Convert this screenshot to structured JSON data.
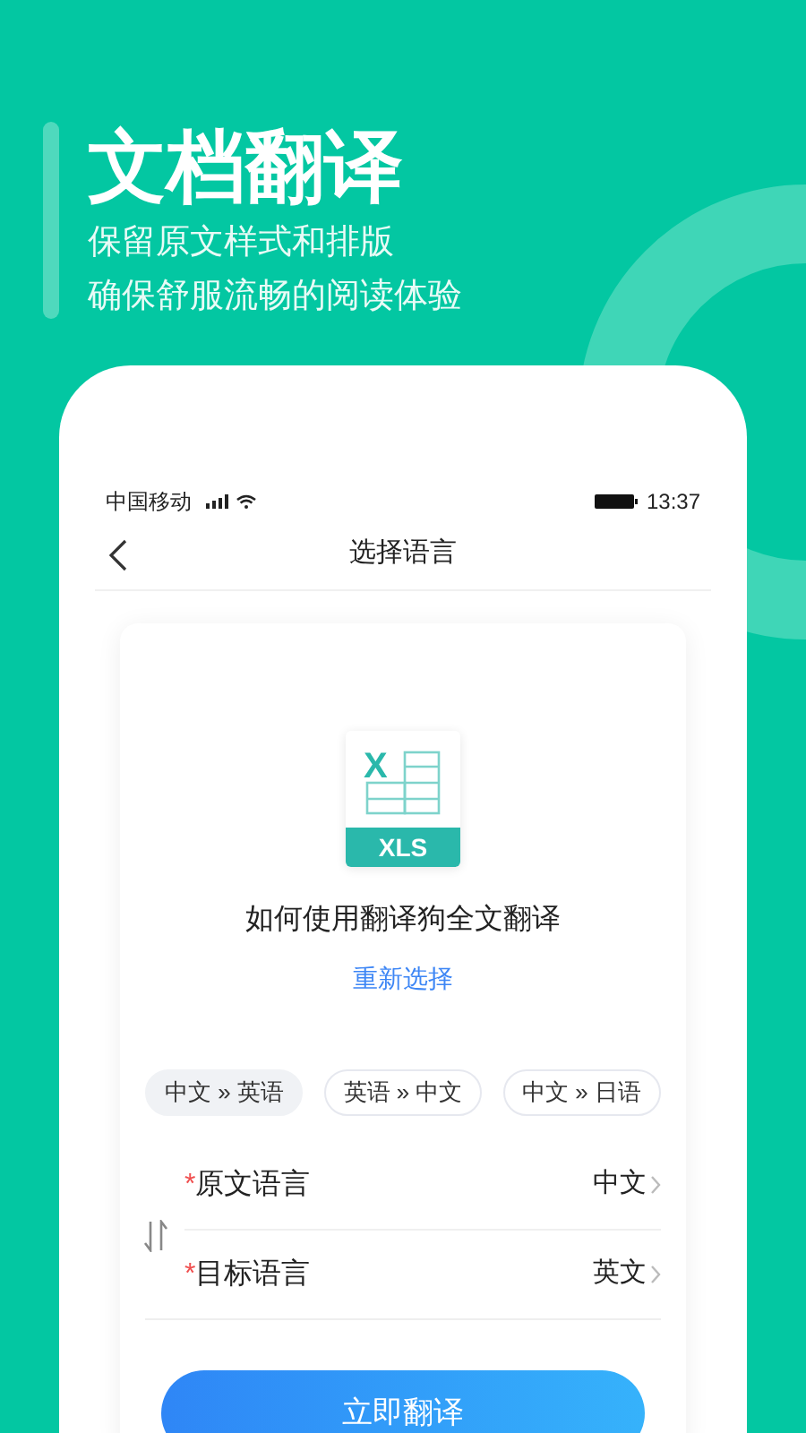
{
  "headline": {
    "title": "文档翻译",
    "lines": [
      "保留原文样式和排版",
      "确保舒服流畅的阅读体验"
    ]
  },
  "status_bar": {
    "carrier": "中国移动",
    "time": "13:37"
  },
  "nav": {
    "title": "选择语言"
  },
  "document": {
    "icon_letter": "X",
    "badge": "XLS",
    "name": "如何使用翻译狗全文翻译",
    "reselect": "重新选择"
  },
  "presets": [
    {
      "label": "中文 » 英语",
      "selected": true
    },
    {
      "label": "英语 » 中文",
      "selected": false
    },
    {
      "label": "中文 » 日语",
      "selected": false
    }
  ],
  "fields": [
    {
      "marker": "*",
      "label": "原文语言",
      "value": "中文"
    },
    {
      "marker": "*",
      "label": "目标语言",
      "value": "英文"
    }
  ],
  "button": {
    "label": "立即翻译"
  }
}
